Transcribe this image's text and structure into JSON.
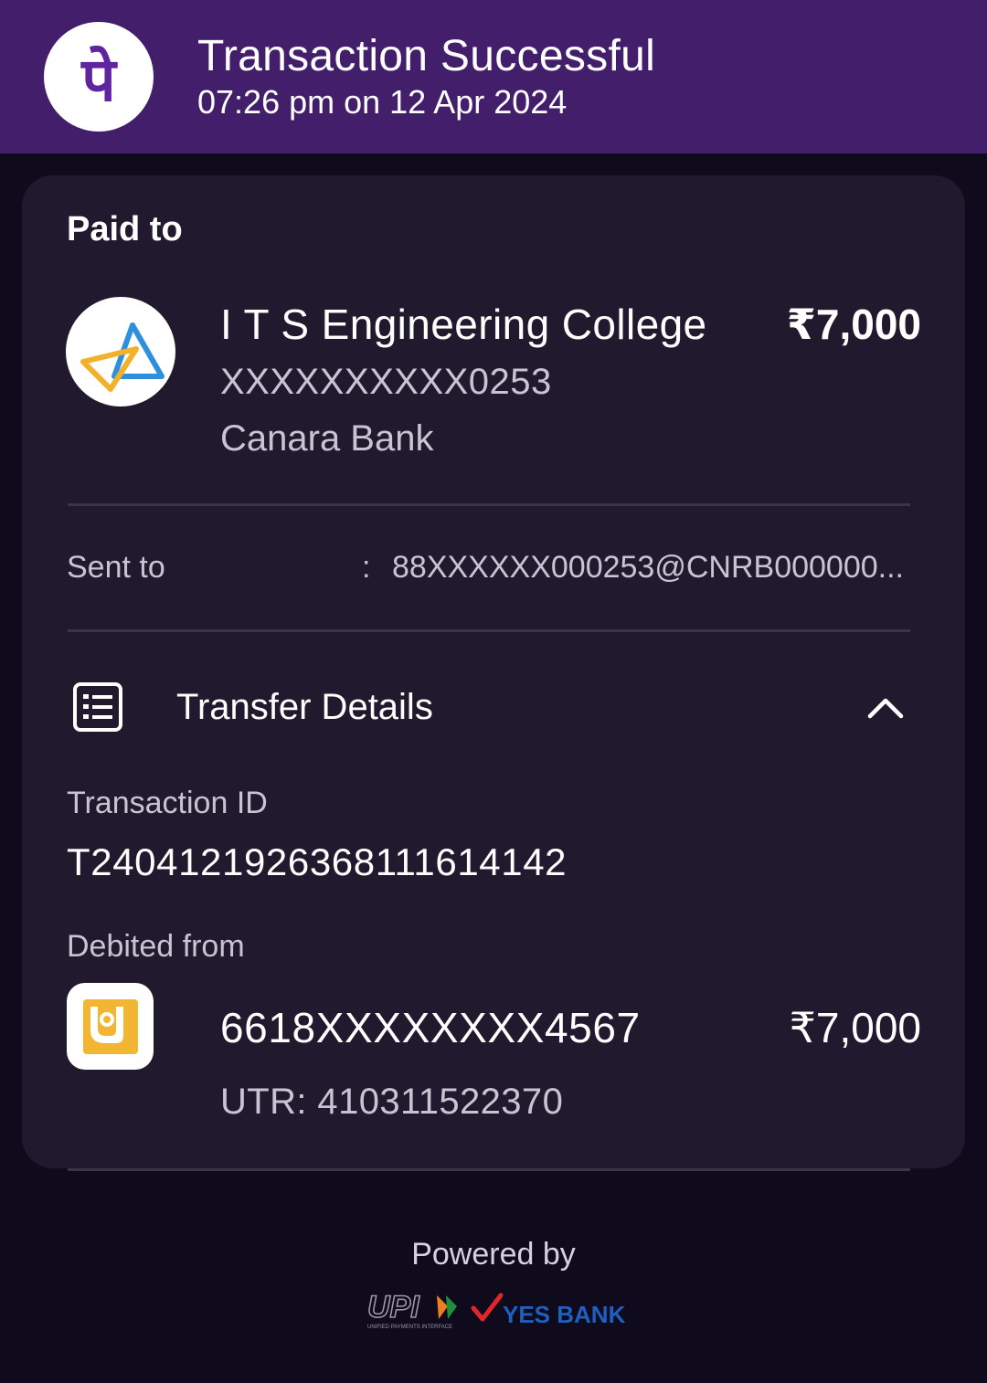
{
  "header": {
    "title": "Transaction Successful",
    "subtitle": "07:26 pm on 12 Apr 2024",
    "logo_icon": "phonepe-logo-icon",
    "logo_glyph": "पे",
    "background": "#431f6b"
  },
  "paid_to": {
    "label": "Paid to",
    "payee_icon": "college-logo-icon",
    "name": "I T S Engineering College",
    "amount": "₹7,000",
    "account": "XXXXXXXXXX0253",
    "bank": "Canara Bank"
  },
  "sent_to": {
    "label": "Sent to",
    "separator": ":",
    "value": "88XXXXXX000253@CNRB000000..."
  },
  "transfer_details": {
    "label": "Transfer Details",
    "icon": "receipt-list-icon",
    "toggle_icon": "chevron-up-icon",
    "transaction_id_label": "Transaction ID",
    "transaction_id": "T2404121926368111614142",
    "debited_from_label": "Debited from",
    "bank_icon": "punjab-national-bank-logo-icon",
    "debit_account": "6618XXXXXXXX4567",
    "debit_amount": "₹7,000",
    "utr": "UTR: 410311522370"
  },
  "footer": {
    "powered_by": "Powered by",
    "upi_logo_text": "UPI",
    "upi_logo_subtext": "UNIFIED PAYMENTS INTERFACE",
    "bank_logo_text": "YES BANK"
  },
  "colors": {
    "page_background": "#0f0a1c",
    "card_background": "#211a2e",
    "brand_purple": "#5f259f",
    "secondary_text": "#c9c4d1",
    "yes_bank_blue": "#1f5fbf",
    "yes_bank_red": "#e3262b"
  }
}
